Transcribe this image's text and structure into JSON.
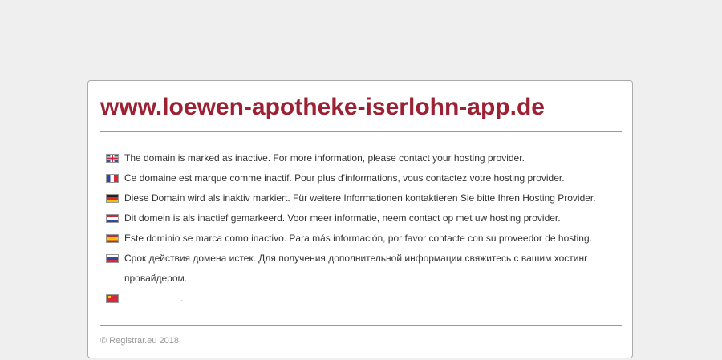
{
  "page": {
    "title": "www.loewen-apotheke-iserlohn-app.de"
  },
  "messages": [
    {
      "flag": "flag-uk-icon",
      "text": "The domain is marked as inactive. For more information, please contact your hosting provider."
    },
    {
      "flag": "flag-fr-icon",
      "text": "Ce domaine est marque comme inactif. Pour plus d'informations, vous contactez votre hosting provider."
    },
    {
      "flag": "flag-de-icon",
      "text": "Diese Domain wird als inaktiv markiert. Für weitere Informationen kontaktieren Sie bitte Ihren Hosting Provider."
    },
    {
      "flag": "flag-nl-icon",
      "text": "Dit domein is als inactief gemarkeerd. Voor meer informatie, neem contact op met uw hosting provider."
    },
    {
      "flag": "flag-es-icon",
      "text": "Este dominio se marca como inactivo. Para más información, por favor contacte con su proveedor de hosting."
    },
    {
      "flag": "flag-ru-icon",
      "text": "Срок действия домена истек. Для получения дополнительной информации свяжитесь с вашим хостинг провайдером."
    },
    {
      "flag": "flag-cn-icon",
      "text": "."
    }
  ],
  "footer": {
    "text": "© Registrar.eu 2018"
  },
  "colors": {
    "title": "#9c2133",
    "background": "#efefef",
    "panel": "#ffffff",
    "footer": "#999999"
  }
}
